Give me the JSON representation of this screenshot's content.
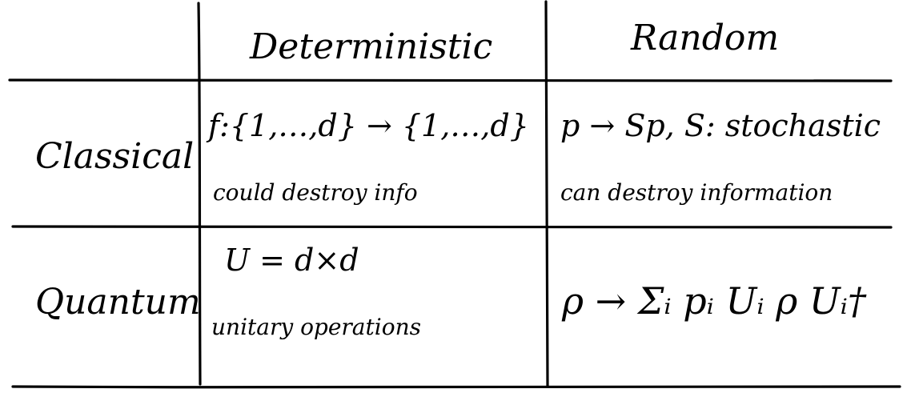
{
  "table": {
    "headers": {
      "deterministic": "Deterministic",
      "random": "Random"
    },
    "rows": {
      "classical": "Classical",
      "quantum": "Quantum"
    },
    "cells": {
      "classical_deterministic": {
        "formula": "f:{1,…,d} → {1,…,d}",
        "note": "could destroy info"
      },
      "classical_random": {
        "formula": "p → Sp,  S: stochastic",
        "note": "can destroy information"
      },
      "quantum_deterministic": {
        "formula": "U = d×d",
        "note": "unitary operations"
      },
      "quantum_random": {
        "formula": "ρ → Σᵢ pᵢ Uᵢ ρ Uᵢ†"
      }
    }
  }
}
